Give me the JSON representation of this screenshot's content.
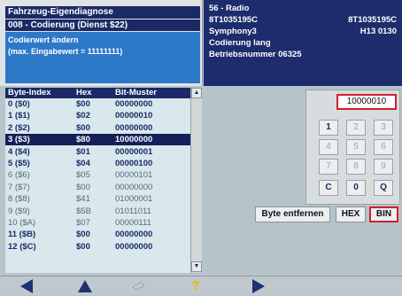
{
  "header": {
    "title": "Fahrzeug-Eigendiagnose",
    "subtitle": "008 - Codierung (Dienst $22)",
    "selection_line1": "Codierwert ändern",
    "selection_line2": "(max. Eingabewert = 11111111)",
    "right": {
      "line1": "56 - Radio",
      "part_left": "8T1035195C",
      "part_right": "8T1035195C",
      "line3_left": "Symphony3",
      "line3_right": "H13 0130",
      "line4": "Codierung lang",
      "line5": "Betriebsnummer 06325"
    }
  },
  "table": {
    "headers": [
      "Byte-Index",
      "Hex",
      "Bit-Muster"
    ],
    "rows": [
      {
        "index": "0 ($0)",
        "hex": "$00",
        "bits": "00000000"
      },
      {
        "index": "1 ($1)",
        "hex": "$02",
        "bits": "00000010"
      },
      {
        "index": "2 ($2)",
        "hex": "$00",
        "bits": "00000000"
      },
      {
        "index": "3 ($3)",
        "hex": "$80",
        "bits": "10000000"
      },
      {
        "index": "4 ($4)",
        "hex": "$01",
        "bits": "00000001"
      },
      {
        "index": "5 ($5)",
        "hex": "$04",
        "bits": "00000100"
      },
      {
        "index": "6 ($6)",
        "hex": "$05",
        "bits": "00000101"
      },
      {
        "index": "7 ($7)",
        "hex": "$00",
        "bits": "00000000"
      },
      {
        "index": "8 ($8)",
        "hex": "$41",
        "bits": "01000001"
      },
      {
        "index": "9 ($9)",
        "hex": "$5B",
        "bits": "01011011"
      },
      {
        "index": "10 ($A)",
        "hex": "$07",
        "bits": "00000111"
      },
      {
        "index": "11 ($B)",
        "hex": "$00",
        "bits": "00000000"
      },
      {
        "index": "12 ($C)",
        "hex": "$00",
        "bits": "00000000"
      }
    ]
  },
  "keypad": {
    "display_value": "10000010",
    "keys": [
      "1",
      "2",
      "3",
      "4",
      "5",
      "6",
      "7",
      "8",
      "9",
      "C",
      "0",
      "Q"
    ]
  },
  "buttons": {
    "remove_byte": "Byte entfernen",
    "hex": "HEX",
    "bin": "BIN"
  },
  "bottom_nav": {
    "question": "?"
  },
  "colors": {
    "header_dark": "#1b2a66",
    "selection_blue": "#2e78c8",
    "highlight_red": "#d0202a",
    "nav_arrow": "#1e3270",
    "help_yellow": "#f0b400"
  }
}
